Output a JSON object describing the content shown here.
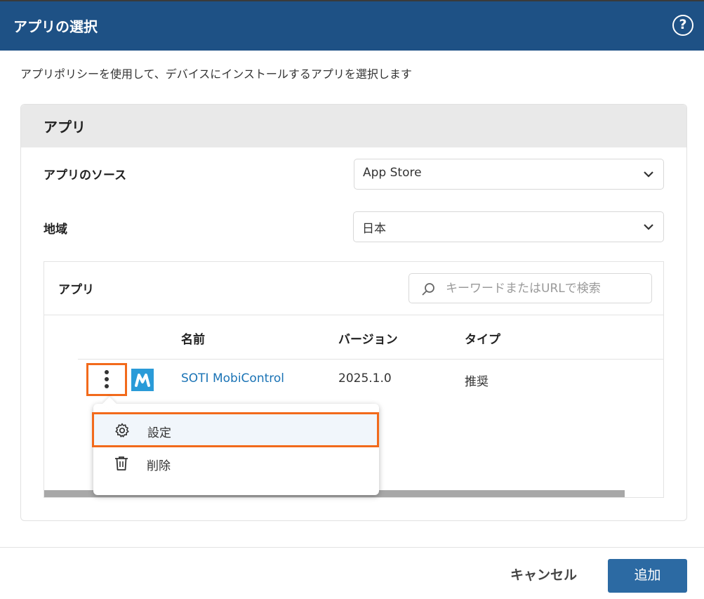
{
  "dialog": {
    "title": "アプリの選択",
    "help_icon": "question-circle-icon",
    "description": "アプリポリシーを使用して、デバイスにインストールするアプリを選択します"
  },
  "panel": {
    "heading": "アプリ",
    "source": {
      "label": "アプリのソース",
      "value": "App Store"
    },
    "region": {
      "label": "地域",
      "value": "日本"
    }
  },
  "apps": {
    "heading": "アプリ",
    "search_placeholder": "キーワードまたはURLで検索",
    "columns": [
      "名前",
      "バージョン",
      "タイプ"
    ],
    "rows": [
      {
        "name": "SOTI MobiControl",
        "version": "2025.1.0",
        "type": "推奨",
        "icon_letter": "M"
      }
    ]
  },
  "context_menu": {
    "items": [
      {
        "label": "設定",
        "icon": "gear-icon",
        "highlighted": true
      },
      {
        "label": "削除",
        "icon": "trash-icon",
        "highlighted": false
      }
    ]
  },
  "footer": {
    "cancel_label": "キャンセル",
    "add_label": "追加"
  },
  "colors": {
    "header": "#1e5185",
    "link": "#1a73b5",
    "primary_button": "#2c6aa3",
    "highlight_border": "#f26a1b"
  }
}
